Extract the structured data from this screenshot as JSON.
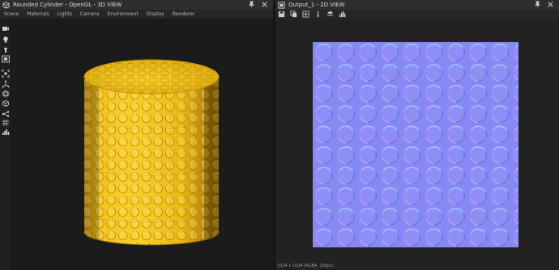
{
  "left_panel": {
    "title": "Rounded Cylinder - OpenGL - 3D VIEW",
    "title_icon": "cube-view-icon",
    "menu": [
      "Scene",
      "Materials",
      "Lights",
      "Camera",
      "Environment",
      "Display",
      "Renderer"
    ]
  },
  "right_panel": {
    "title": "Output_1 - 2D VIEW",
    "title_icon": "image-view-icon",
    "status": "1024 x 1024 (RGBA, 16bpc)"
  },
  "colors": {
    "cylinder_yellow": "#f2c21b",
    "normal_blue": "#8a8cf4",
    "panel_bg": "#222222",
    "viewport_bg": "#1b1b1b"
  },
  "sidebar_icons": [
    "camera-icon",
    "light-bulb-icon",
    "light-icon",
    "screenshot-icon",
    "fit-view-icon",
    "axis-icon",
    "cube-icon",
    "wireframe-cube-icon",
    "nodes-icon",
    "grid-icon",
    "histogram-icon"
  ],
  "toolbar_icons": [
    "save-icon",
    "copy-icon",
    "grid-icon",
    "info-icon",
    "layers-icon",
    "histogram-icon"
  ]
}
